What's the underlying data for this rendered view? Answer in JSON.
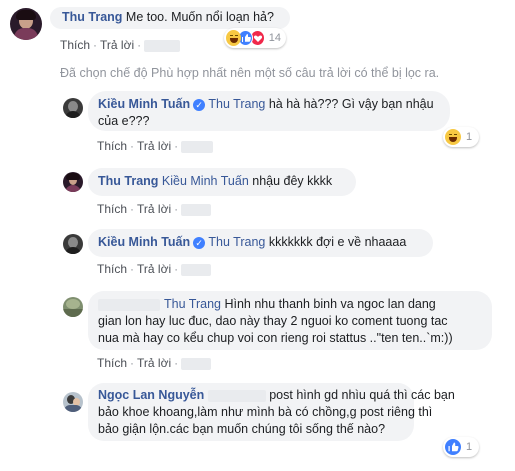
{
  "comments": [
    {
      "author": "Thu Trang",
      "text": "Me too. Muốn nổi loạn hả?",
      "like": "Thích",
      "reply": "Trả lời",
      "reaction_count": "14"
    },
    {
      "author": "Kiều Minh Tuấn",
      "mention": "Thu Trang",
      "text": "hà hà hà??? Gì vậy bạn nhậu của e???",
      "like": "Thích",
      "reply": "Trả lời",
      "reaction_count": "1"
    },
    {
      "author": "Thu Trang",
      "mention": "Kiều Minh Tuấn",
      "text": "nhậu đêy kkkk",
      "like": "Thích",
      "reply": "Trả lời"
    },
    {
      "author": "Kiều Minh Tuấn",
      "mention": "Thu Trang",
      "text": "kkkkkkk đợi e về nhaaaa",
      "like": "Thích",
      "reply": "Trả lời"
    },
    {
      "mention": "Thu Trang",
      "text_line1": "Hình nhu thanh binh va ngoc lan dang",
      "text_line2": "gian lon hay luc đuc, dao này thay 2 nguoi ko coment tuong tac",
      "text_line3": "nua mà hay co kểu chup voi con rieng roi stattus ..\"ten ten..`m:))",
      "like": "Thích",
      "reply": "Trả lời"
    },
    {
      "author": "Ngọc Lan Nguyễn",
      "text_line1": "post hình gd nhìu quá thì các bạn",
      "text_line2": "bảo khoe khoang,làm như mình bà có chồng,g post riêng thì",
      "text_line3": "bảo giận lộn.các bạn muốn chúng tôi sống thế nào?",
      "reaction_count": "1"
    }
  ],
  "filter_notice": "Đã chọn chế độ Phù hợp nhất nên một số câu trả lời có thể bị lọc ra.",
  "verified_mark": "✓",
  "colors": {
    "link": "#385898",
    "bubble": "#f2f3f5",
    "meta": "#90949c",
    "like_blue": "#4080ff",
    "haha_yellow": "#f7c843",
    "love_red": "#f0284a"
  }
}
